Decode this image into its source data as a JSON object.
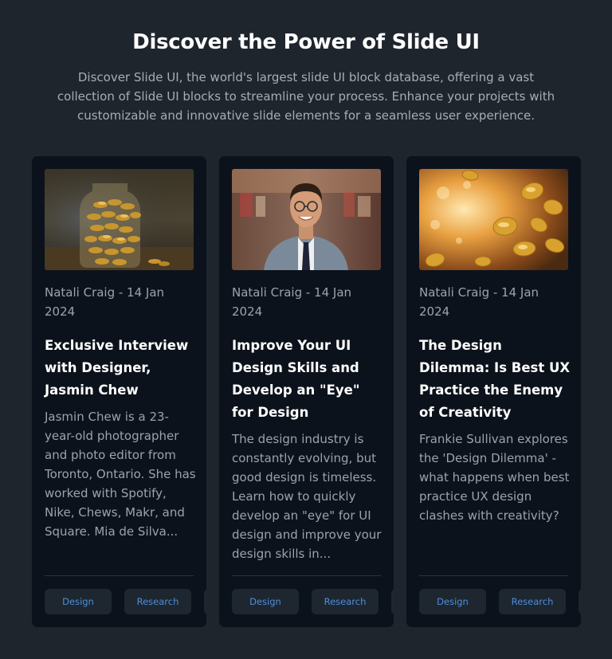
{
  "header": {
    "title": "Discover the Power of Slide UI",
    "intro": "Discover Slide UI, the world's largest slide UI block database, offering a vast collection of Slide UI blocks to streamline your process. Enhance your projects with customizable and innovative slide elements for a seamless user experience."
  },
  "cards": [
    {
      "meta": "Natali Craig - 14 Jan 2024",
      "title": "Exclusive Interview with Designer, Jasmin Chew",
      "excerpt": "Jasmin Chew is a 23-year-old photographer and photo editor from Toronto, Ontario. She has worked with Spotify, Nike, Chews, Makr, and Square. Mia de Silva...",
      "tags": [
        "Design",
        "Research",
        ""
      ]
    },
    {
      "meta": "Natali Craig - 14 Jan 2024",
      "title": "Improve Your UI Design Skills and Develop an \"Eye\" for Design",
      "excerpt": "The design industry is constantly evolving, but good design is timeless. Learn how to quickly develop an \"eye\" for UI design and improve your design skills in...",
      "tags": [
        "Design",
        "Research",
        ""
      ]
    },
    {
      "meta": "Natali Craig - 14 Jan 2024",
      "title": "The Design Dilemma: Is Best UX Practice the Enemy of Creativity",
      "excerpt": "Frankie Sullivan explores the 'Design Dilemma' - what happens when best practice UX design clashes with creativity?",
      "tags": [
        "Design",
        "Research",
        ""
      ]
    }
  ],
  "colors": {
    "background": "#1f252d",
    "card": "#0c121b",
    "tag_text": "#4d8fdc",
    "tag_bg": "#1e2630"
  }
}
